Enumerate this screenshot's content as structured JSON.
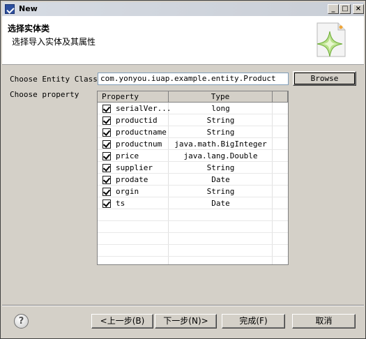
{
  "window": {
    "title": "New"
  },
  "header": {
    "title": "选择实体类",
    "subtitle": "选择导入实体及其属性"
  },
  "form": {
    "entity_class_label": "Choose Entity Class",
    "entity_class_value": "com.yonyou.iuap.example.entity.Product",
    "browse_label": "Browse",
    "property_label": "Choose property"
  },
  "table": {
    "headers": {
      "property": "Property",
      "type": "Type"
    },
    "rows": [
      {
        "name": "serialVer...",
        "type": "long",
        "checked": true
      },
      {
        "name": "productid",
        "type": "String",
        "checked": true
      },
      {
        "name": "productname",
        "type": "String",
        "checked": true
      },
      {
        "name": "productnum",
        "type": "java.math.BigInteger",
        "checked": true
      },
      {
        "name": "price",
        "type": "java.lang.Double",
        "checked": true
      },
      {
        "name": "supplier",
        "type": "String",
        "checked": true
      },
      {
        "name": "prodate",
        "type": "Date",
        "checked": true
      },
      {
        "name": "orgin",
        "type": "String",
        "checked": true
      },
      {
        "name": "ts",
        "type": "Date",
        "checked": true
      }
    ]
  },
  "buttons": {
    "help": "?",
    "back": "<上一步(B)",
    "next": "下一步(N)>",
    "finish": "完成(F)",
    "cancel": "取消"
  },
  "icons": {
    "app": "eclipse-wizard-icon",
    "wizard_banner": "new-wizard-sparkle-icon",
    "help": "help-icon",
    "checkbox": "checkbox-checked-icon"
  }
}
